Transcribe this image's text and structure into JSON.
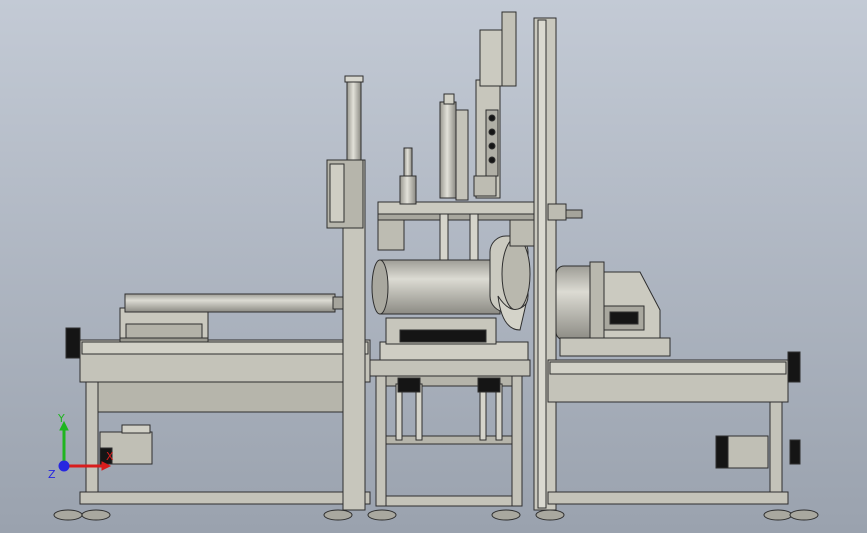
{
  "view": {
    "background_top": "#c3cad5",
    "background_bottom": "#9aa2ae"
  },
  "palette": {
    "metal": "#bdbcb2",
    "metal_light": "#d6d5cc",
    "metal_dark": "#8d8c84",
    "edge": "#2e2e2e",
    "black": "#151515"
  },
  "triad": {
    "x_label": "X",
    "y_label": "Y",
    "z_label": "Z",
    "x_color": "#d81d1d",
    "y_color": "#1fb51f",
    "z_color": "#2727e0"
  }
}
